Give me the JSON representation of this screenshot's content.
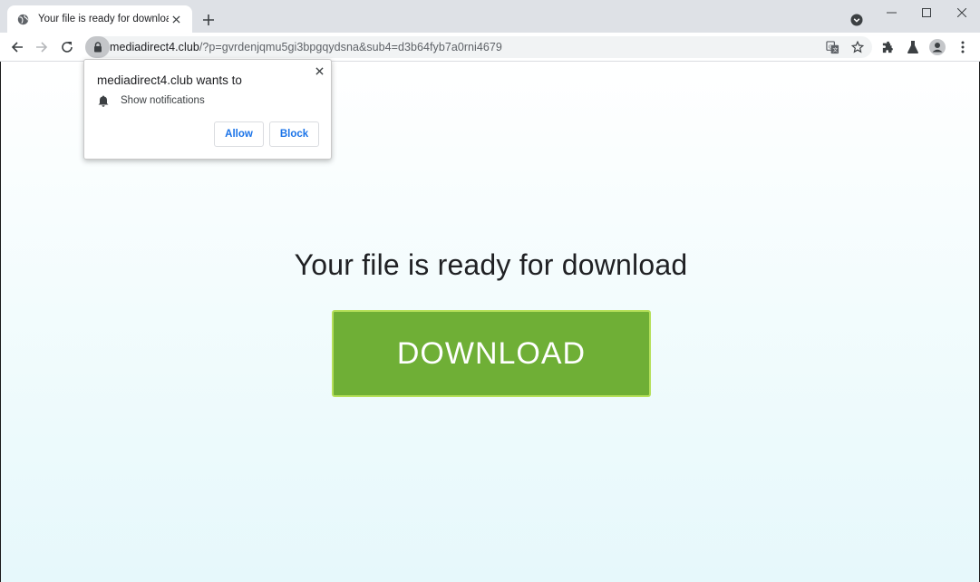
{
  "browser": {
    "tab": {
      "title": "Your file is ready for download",
      "favicon": "globe-icon"
    },
    "address_bar": {
      "host": "mediadirect4.club",
      "path": "/?p=gvrdenjqmu5gi3bpgqydsna&sub4=d3b64fyb7a0rni4679"
    },
    "icons": [
      "back-icon",
      "forward-icon",
      "reload-icon",
      "lock-icon",
      "translate-icon",
      "star-icon",
      "extensions-icon",
      "labs-icon",
      "profile-icon",
      "menu-icon",
      "tab-search-icon",
      "minimize-icon",
      "maximize-icon",
      "close-icon",
      "new-tab-icon"
    ]
  },
  "permission_popup": {
    "title": "mediadirect4.club wants to",
    "permission": "Show notifications",
    "allow_label": "Allow",
    "block_label": "Block"
  },
  "page": {
    "headline": "Your file is ready for download",
    "download_button_label": "DOWNLOAD"
  },
  "colors": {
    "download_button": "#6faf36",
    "download_border": "#b6e05a",
    "link_blue": "#1a73e8"
  }
}
